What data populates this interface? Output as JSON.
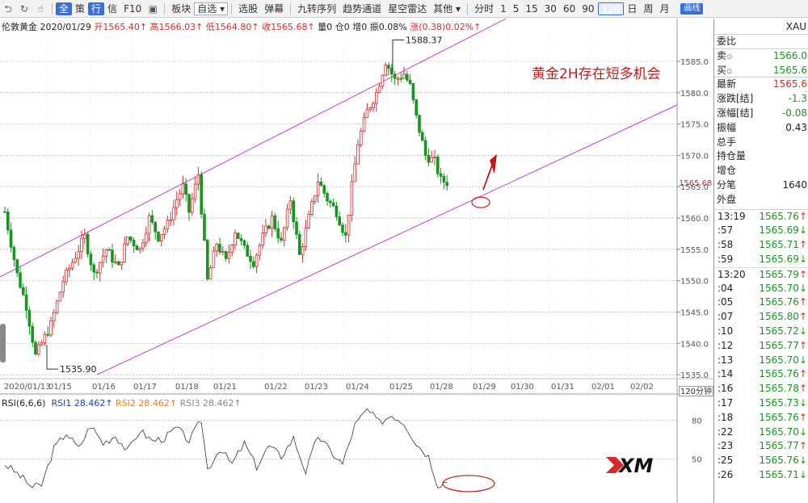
{
  "toolbar": {
    "nav_icons": [
      "back-icon",
      "refresh-icon",
      "pointer-icon"
    ],
    "views": [
      {
        "label": "全",
        "active": true
      },
      {
        "label": "策",
        "active": false
      },
      {
        "label": "行",
        "active": true
      },
      {
        "label": "信",
        "active": false
      },
      {
        "label": "F10",
        "active": false
      }
    ],
    "board_label": "板块",
    "watchlist_label": "自选",
    "tools": [
      "选股",
      "弹幕",
      "九转序列",
      "趋势通道",
      "星空雷达",
      "其他"
    ],
    "periods": [
      "分时",
      "1",
      "5",
      "15",
      "30",
      "60",
      "90",
      "120",
      "日",
      "周",
      "月"
    ],
    "active_period": "120",
    "flag_label": "画线"
  },
  "chart": {
    "instrument": "伦敦黄金",
    "date": "2020/01/29",
    "ohlc": {
      "open_label": "开",
      "open": "1565.40↑",
      "high_label": "高",
      "high": "1566.03↑",
      "low_label": "低",
      "low": "1564.80↑",
      "close_label": "收",
      "close": "1565.68↑",
      "volume_label": "量",
      "volume": "0",
      "position_label": "仓",
      "position": "0",
      "increase_label": "增",
      "increase": "0",
      "amplitude_label": "振",
      "amplitude": "0.08%",
      "change_label": "涨",
      "change": "(0.38)0.02%↑"
    },
    "period_tag": "120分钟",
    "annotation": "黄金2H存在短多机会",
    "rsi": {
      "title": "RSI(6,6,6)",
      "rsi1_label": "RSI1",
      "rsi1": "28.462↑",
      "rsi2_label": "RSI2",
      "rsi2": "28.462↑",
      "rsi3_label": "RSI3",
      "rsi3": "28.462↑"
    },
    "logo_text": "XM"
  },
  "chart_data": {
    "type": "candlestick",
    "y_ticks": [
      1535,
      1540,
      1545,
      1550,
      1555,
      1560,
      1565,
      1570,
      1575,
      1580,
      1585
    ],
    "ylim": [
      1534.5,
      1589.5
    ],
    "x_ticks": [
      "2020/01/13",
      "01/15",
      "01/16",
      "01/17",
      "01/18",
      "01/21",
      "01/22",
      "01/23",
      "01/24",
      "01/25",
      "01/28",
      "01/29",
      "01/30",
      "01/31",
      "02/01",
      "02/02"
    ],
    "high_label": "1588.37",
    "low_label": "1535.90",
    "last_price": "1565.68",
    "anchors": [
      [
        0,
        1561
      ],
      [
        4,
        1551
      ],
      [
        7,
        1546
      ],
      [
        10,
        1538
      ],
      [
        12,
        1540
      ],
      [
        15,
        1543
      ],
      [
        19,
        1550
      ],
      [
        23,
        1554
      ],
      [
        26,
        1557
      ],
      [
        29,
        1551
      ],
      [
        33,
        1555
      ],
      [
        37,
        1552
      ],
      [
        40,
        1557
      ],
      [
        44,
        1555
      ],
      [
        47,
        1560
      ],
      [
        50,
        1557
      ],
      [
        53,
        1559
      ],
      [
        56,
        1563
      ],
      [
        58,
        1565
      ],
      [
        60,
        1561
      ],
      [
        63,
        1567
      ],
      [
        66,
        1550
      ],
      [
        69,
        1556
      ],
      [
        72,
        1553
      ],
      [
        75,
        1558
      ],
      [
        78,
        1555
      ],
      [
        81,
        1553
      ],
      [
        84,
        1557
      ],
      [
        87,
        1560
      ],
      [
        90,
        1556
      ],
      [
        93,
        1563
      ],
      [
        96,
        1554
      ],
      [
        99,
        1560
      ],
      [
        102,
        1566
      ],
      [
        105,
        1563
      ],
      [
        108,
        1561
      ],
      [
        111,
        1557
      ],
      [
        113,
        1565
      ],
      [
        115,
        1572
      ],
      [
        118,
        1577
      ],
      [
        121,
        1580
      ],
      [
        124,
        1585
      ],
      [
        127,
        1582
      ],
      [
        130,
        1583
      ],
      [
        132,
        1581
      ],
      [
        134,
        1576
      ],
      [
        137,
        1570
      ],
      [
        140,
        1569
      ],
      [
        142,
        1566
      ],
      [
        144,
        1565.7
      ]
    ],
    "channel_upper": [
      [
        0,
        1551
      ],
      [
        160,
        1591
      ]
    ],
    "channel_lower": [
      [
        30,
        1535
      ],
      [
        210,
        1576
      ]
    ],
    "rsi_ticks": [
      50,
      80
    ],
    "rsi_lim": [
      16,
      92
    ],
    "rsi_anchors": [
      [
        0,
        46
      ],
      [
        5,
        37
      ],
      [
        9,
        28
      ],
      [
        12,
        30
      ],
      [
        16,
        58
      ],
      [
        20,
        70
      ],
      [
        24,
        58
      ],
      [
        28,
        76
      ],
      [
        32,
        62
      ],
      [
        36,
        68
      ],
      [
        40,
        56
      ],
      [
        44,
        72
      ],
      [
        48,
        64
      ],
      [
        52,
        66
      ],
      [
        56,
        74
      ],
      [
        60,
        64
      ],
      [
        64,
        80
      ],
      [
        66,
        42
      ],
      [
        70,
        58
      ],
      [
        74,
        46
      ],
      [
        78,
        62
      ],
      [
        82,
        44
      ],
      [
        86,
        60
      ],
      [
        90,
        52
      ],
      [
        94,
        66
      ],
      [
        98,
        40
      ],
      [
        102,
        68
      ],
      [
        106,
        56
      ],
      [
        110,
        46
      ],
      [
        114,
        76
      ],
      [
        118,
        88
      ],
      [
        122,
        78
      ],
      [
        126,
        84
      ],
      [
        130,
        78
      ],
      [
        134,
        62
      ],
      [
        138,
        52
      ],
      [
        141,
        30
      ],
      [
        144,
        33
      ]
    ]
  },
  "panel": {
    "symbol": "XAU",
    "weibi_label": "委比",
    "sell_label": "卖",
    "sell": "1566.0",
    "buy_label": "买",
    "buy": "1565.6",
    "stats": [
      {
        "label": "最新",
        "value": "1565.6",
        "color": "up"
      },
      {
        "label": "涨跌[结]",
        "value": "-1.3",
        "color": "dn"
      },
      {
        "label": "涨幅[结]",
        "value": "-0.08",
        "color": "dn"
      },
      {
        "label": "振幅",
        "value": "0.43",
        "color": "none"
      },
      {
        "label": "总手",
        "value": "",
        "color": "none"
      },
      {
        "label": "持仓量",
        "value": "",
        "color": "none"
      },
      {
        "label": "增仓",
        "value": "",
        "color": "none"
      },
      {
        "label": "分笔",
        "value": "1640",
        "color": "none"
      },
      {
        "label": "外盘",
        "value": "",
        "color": "none"
      }
    ],
    "ticks": [
      {
        "time": "13:19",
        "price": "1565.76",
        "dir": "↑"
      },
      {
        "time": ":57",
        "price": "1565.69",
        "dir": "↓"
      },
      {
        "time": ":58",
        "price": "1565.71",
        "dir": "↑"
      },
      {
        "time": ":59",
        "price": "1565.69",
        "dir": "↓"
      },
      {
        "time": "13:20",
        "price": "1565.79",
        "dir": "↑"
      },
      {
        "time": ":04",
        "price": "1565.70",
        "dir": "↓"
      },
      {
        "time": ":05",
        "price": "1565.76",
        "dir": "↑"
      },
      {
        "time": ":07",
        "price": "1565.80",
        "dir": "↑"
      },
      {
        "time": ":10",
        "price": "1565.72",
        "dir": "↓"
      },
      {
        "time": ":12",
        "price": "1565.77",
        "dir": "↑"
      },
      {
        "time": ":13",
        "price": "1565.70",
        "dir": "↓"
      },
      {
        "time": ":14",
        "price": "1565.76",
        "dir": "↑"
      },
      {
        "time": ":16",
        "price": "1565.78",
        "dir": "↑"
      },
      {
        "time": ":17",
        "price": "1565.73",
        "dir": "↓"
      },
      {
        "time": ":18",
        "price": "1565.76",
        "dir": "↑"
      },
      {
        "time": ":22",
        "price": "1565.70",
        "dir": "↓"
      },
      {
        "time": ":23",
        "price": "1565.77",
        "dir": "↑"
      },
      {
        "time": ":25",
        "price": "1565.76",
        "dir": "↓"
      },
      {
        "time": ":26",
        "price": "1565.71",
        "dir": "↓"
      }
    ]
  },
  "colors": {
    "up": "#d42a2a",
    "down": "#17961f",
    "channel": "#c83cd2",
    "annotation": "#c21a1a"
  }
}
